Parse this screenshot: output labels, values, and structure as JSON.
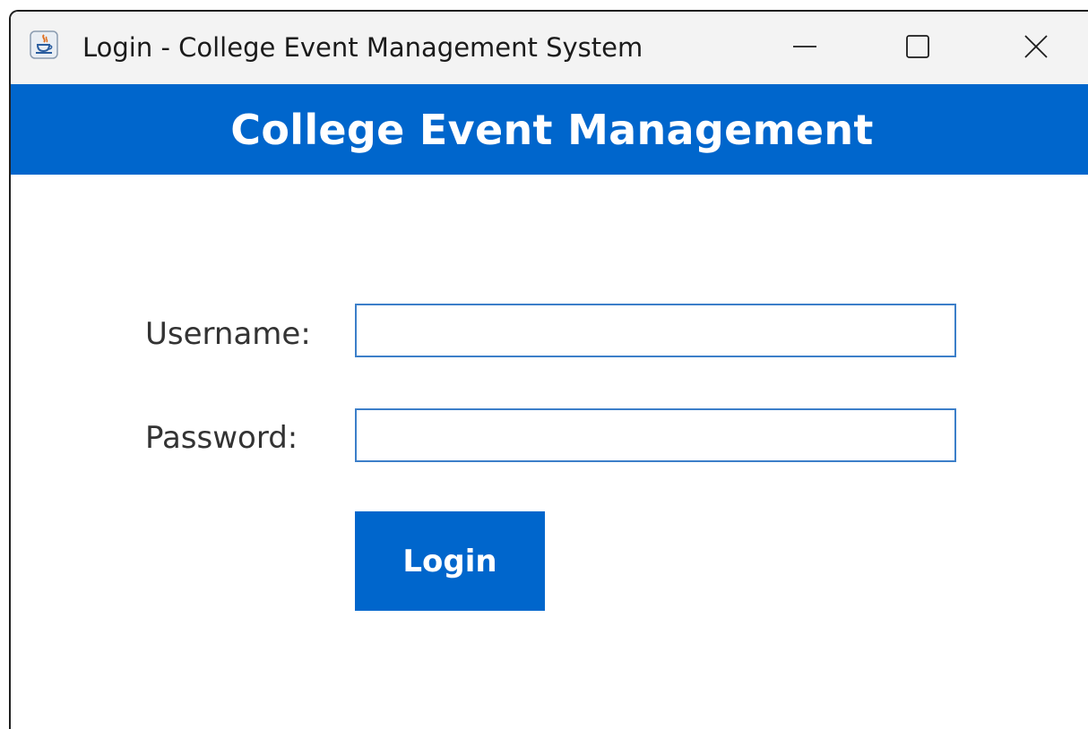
{
  "window": {
    "title": "Login - College Event Management System",
    "app_icon": "java-icon",
    "controls": {
      "minimize_icon": "minimize-icon",
      "maximize_icon": "maximize-icon",
      "close_icon": "close-icon"
    }
  },
  "header": {
    "title": "College Event Management"
  },
  "form": {
    "username_label": "Username:",
    "username_value": "",
    "password_label": "Password:",
    "password_value": "",
    "login_label": "Login"
  },
  "colors": {
    "accent": "#0066cc",
    "titlebar": "#f3f3f3",
    "field_border": "#3c7fc9",
    "label_text": "#333333"
  }
}
